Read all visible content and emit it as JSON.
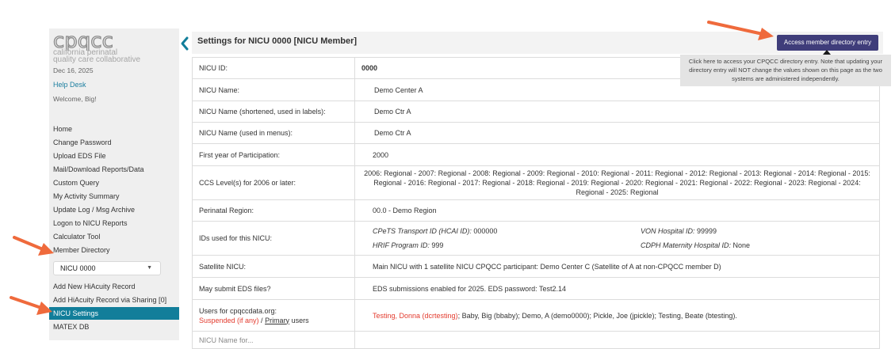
{
  "sidebar": {
    "logo_text": "cpqcc",
    "tagline_1": "california perinatal",
    "tagline_2": "quality care collaborative",
    "date": "Dec 16, 2025",
    "help_desk": "Help Desk",
    "welcome": "Welcome, Big!",
    "nav_top": [
      "Home",
      "Change Password",
      "Upload EDS File",
      "Mail/Download Reports/Data",
      "Custom Query",
      "My Activity Summary",
      "Update Log / Msg Archive",
      "Logon to NICU Reports",
      "Calculator Tool",
      "Member Directory"
    ],
    "nicu_select": "NICU 0000",
    "nav_bottom": [
      "Add New HiAcuity Record",
      "Add HiAcuity Record via Sharing [0]",
      "NICU Settings",
      "MATEX DB"
    ],
    "active_item": "NICU Settings"
  },
  "header": {
    "title": "Settings for NICU 0000 [NICU Member]",
    "access_button": "Access member directory entry",
    "tooltip": "Click here to access your CPQCC directory entry. Note that updating your directory entry will NOT change the values shown on this page as the two systems are administered independently."
  },
  "settings": {
    "nicu_id": {
      "label": "NICU ID:",
      "value": "0000"
    },
    "nicu_name": {
      "label": "NICU Name:",
      "value": "Demo Center A"
    },
    "nicu_name_short": {
      "label": "NICU Name (shortened, used in labels):",
      "value": "Demo Ctr A"
    },
    "nicu_name_menus": {
      "label": "NICU Name (used in menus):",
      "value": "Demo Ctr A"
    },
    "first_year": {
      "label": "First year of Participation:",
      "value": "2000"
    },
    "ccs_levels": {
      "label": "CCS Level(s) for 2006 or later:",
      "value": "2006: Regional  -  2007: Regional  -  2008: Regional  -  2009: Regional  -  2010: Regional  -  2011: Regional  -  2012: Regional  -  2013: Regional  -  2014: Regional  -  2015: Regional  -  2016: Regional  -  2017: Regional  -  2018: Regional  -  2019: Regional  -  2020: Regional  -  2021: Regional  -  2022: Regional  -  2023: Regional  -  2024: Regional  -  2025: Regional"
    },
    "perinatal_region": {
      "label": "Perinatal Region:",
      "value": "00.0 - Demo Region"
    },
    "ids": {
      "label": "IDs used for this NICU:",
      "cpets_label": "CPeTS Transport ID (HCAI ID):",
      "cpets_value": " 000000",
      "von_label": "VON Hospital ID:",
      "von_value": " 99999",
      "hrif_label": "HRIF Program ID:",
      "hrif_value": " 999",
      "cdph_label": "CDPH Maternity Hospital ID:",
      "cdph_value": " None"
    },
    "satellite": {
      "label": "Satellite NICU:",
      "value": "Main NICU with 1 satellite NICU CPQCC participant: Demo Center C (Satellite of A at non-CPQCC member D)"
    },
    "eds": {
      "label": "May submit EDS files?",
      "value": "EDS submissions enabled for 2025. EDS password: Test2.14"
    },
    "users": {
      "label": "Users for cpqccdata.org:",
      "suspended": "Suspended (if any)",
      "slash": " / ",
      "primary": "Primary",
      "users_word": " users",
      "suspended_user": "Testing, Donna (dcrtesting)",
      "others": "; Baby, Big (bbaby); Demo, A (demo0000); Pickle, Joe (jpickle); Testing, Beate (btesting)."
    },
    "partial_label": "NICU Name for..."
  },
  "colors": {
    "accent": "#127e9a",
    "button": "#3f3d7a",
    "alert_red": "#e33b2e",
    "arrow": "#ef6a3c"
  }
}
